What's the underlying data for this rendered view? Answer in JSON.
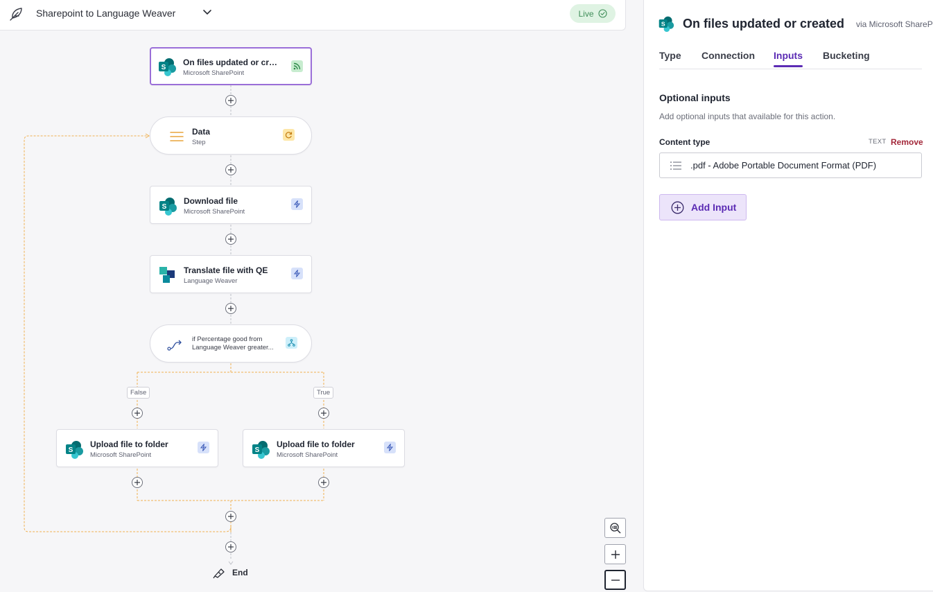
{
  "header": {
    "workflow_title": "Sharepoint to Language Weaver",
    "status": "Live"
  },
  "flow": {
    "nodes": [
      {
        "title": "On files updated or created",
        "subtitle": "Microsoft SharePoint",
        "icon": "sharepoint-icon",
        "badge": "rss-icon"
      },
      {
        "title": "Data",
        "subtitle": "Step",
        "icon": "list-icon",
        "badge": "loop-icon"
      },
      {
        "title": "Download file",
        "subtitle": "Microsoft SharePoint",
        "icon": "sharepoint-icon",
        "badge": "lightning-icon"
      },
      {
        "title": "Translate file with QE",
        "subtitle": "Language Weaver",
        "icon": "language-weaver-icon",
        "badge": "lightning-icon"
      },
      {
        "title": "if Percentage good from Language Weaver greater...",
        "icon": "route-icon",
        "badge": "branch-icon"
      },
      {
        "title": "Upload file to folder",
        "subtitle": "Microsoft SharePoint",
        "icon": "sharepoint-icon",
        "badge": "lightning-icon"
      },
      {
        "title": "Upload file to folder",
        "subtitle": "Microsoft SharePoint",
        "icon": "sharepoint-icon",
        "badge": "lightning-icon"
      }
    ],
    "branch_false_label": "False",
    "branch_true_label": "True",
    "end_label": "End"
  },
  "panel": {
    "title": "On files updated or created",
    "via": "via Microsoft SharePoint",
    "tabs": [
      "Type",
      "Connection",
      "Inputs",
      "Bucketing"
    ],
    "active_tab": "Inputs",
    "section_title": "Optional inputs",
    "section_description": "Add optional inputs that available for this action.",
    "field": {
      "label": "Content type",
      "type": "TEXT",
      "remove_label": "Remove",
      "value": ".pdf - Adobe Portable Document Format (PDF)"
    },
    "add_input_label": "Add Input"
  },
  "colors": {
    "accent": "#5b2bb4",
    "selected_border": "#9a6ed8",
    "live_bg": "#dff3e3",
    "wire_orange": "#f0b050",
    "remove_red": "#a3283a"
  }
}
